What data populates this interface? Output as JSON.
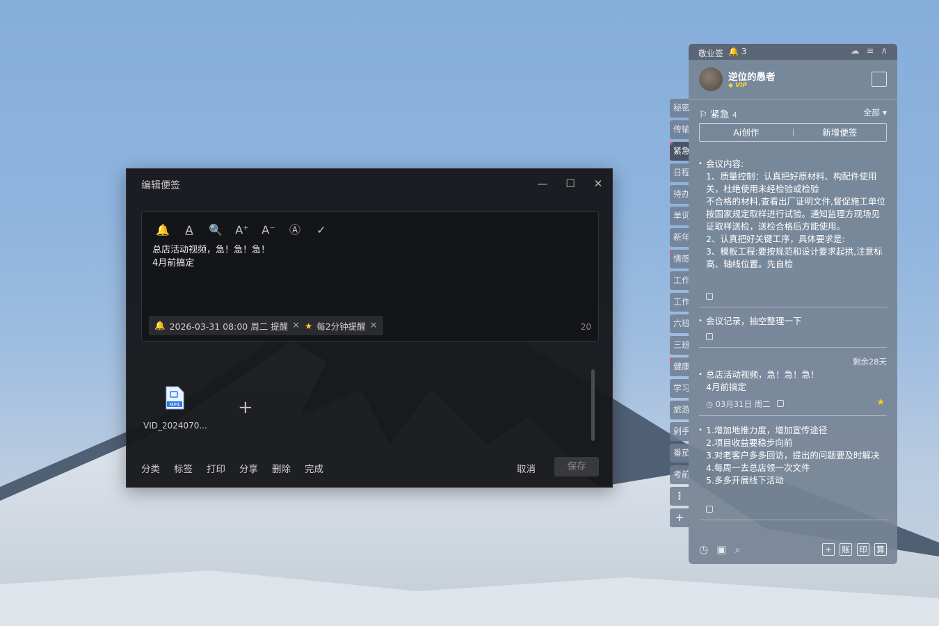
{
  "dialog": {
    "title": "编辑便签",
    "minimize": "—",
    "maximize": "☐",
    "close": "✕",
    "toolbar": [
      "🔔",
      "A",
      "🔍",
      "A⁺",
      "A⁻",
      "Ⓐ",
      "✓"
    ],
    "note_lines": [
      "总店活动视频，急！急！急！",
      "4月前搞定"
    ],
    "reminder_chip": "2026-03-31 08:00 周二 提醒",
    "repeat_chip": "每2分钟提醒",
    "char_count": "20",
    "attachment_name": "VID_2024070...",
    "attachment_type": "MP4",
    "add": "+",
    "footer": [
      "分类",
      "标签",
      "打印",
      "分享",
      "删除",
      "完成"
    ],
    "cancel": "取消",
    "save": "保存"
  },
  "side_tabs": [
    {
      "label": "秘密",
      "dot": false,
      "active": false
    },
    {
      "label": "传输",
      "dot": false,
      "active": false
    },
    {
      "label": "紧急",
      "dot": true,
      "active": true
    },
    {
      "label": "日程",
      "dot": false,
      "active": false
    },
    {
      "label": "待办",
      "dot": false,
      "active": false
    },
    {
      "label": "单词",
      "dot": false,
      "active": false
    },
    {
      "label": "新年",
      "dot": false,
      "active": false
    },
    {
      "label": "情感",
      "dot": true,
      "active": false
    },
    {
      "label": "工作",
      "dot": false,
      "active": false
    },
    {
      "label": "工作",
      "dot": false,
      "active": false
    },
    {
      "label": "六班",
      "dot": false,
      "active": false
    },
    {
      "label": "三班",
      "dot": false,
      "active": false
    },
    {
      "label": "健康",
      "dot": true,
      "active": false
    },
    {
      "label": "学习",
      "dot": false,
      "active": false
    },
    {
      "label": "旅游",
      "dot": false,
      "active": false
    },
    {
      "label": "剁手",
      "dot": false,
      "active": false
    },
    {
      "label": "番茄",
      "dot": false,
      "active": false
    },
    {
      "label": "考前",
      "dot": false,
      "active": false
    }
  ],
  "side_more": "⋮",
  "side_add": "+",
  "panel": {
    "app_name": "敬业签",
    "notif_count": "3",
    "username": "逆位的愚者",
    "vip": "VIP",
    "category": "紧急",
    "category_count": "4",
    "filter": "全部 ▾",
    "ai_btn": "Ai创作",
    "new_btn": "新增便签",
    "notes": [
      {
        "text": "会议内容:\n1、质量控制：认真把好原材料、构配件使用关，杜绝使用未经检验或检验\n不合格的材料,查看出厂证明文件,督促施工单位按国家规定取样进行试验。通知监理方现场见证取样送检，送检合格后方能使用。\n2、认真把好关键工序，具体要求是:\n3、模板工程:要按规范和设计要求起拱,注意标高、轴线位置。先自检"
      },
      {
        "text": "会议记录，抽空整理一下"
      },
      {
        "text": "总店活动视频，急！急！急！\n4月前搞定",
        "remain": "剩余28天",
        "date": "03月31日 周二"
      },
      {
        "text": "1.增加地推力度，增加宣传途径\n2.项目收益要稳步向前\n3.对老客户多多回访，提出的问题要及时解决\n4.每周一去总店领一次文件\n5.多多开展线下活动"
      }
    ],
    "bottom_boxes": [
      "+",
      "账",
      "印",
      "算"
    ]
  }
}
